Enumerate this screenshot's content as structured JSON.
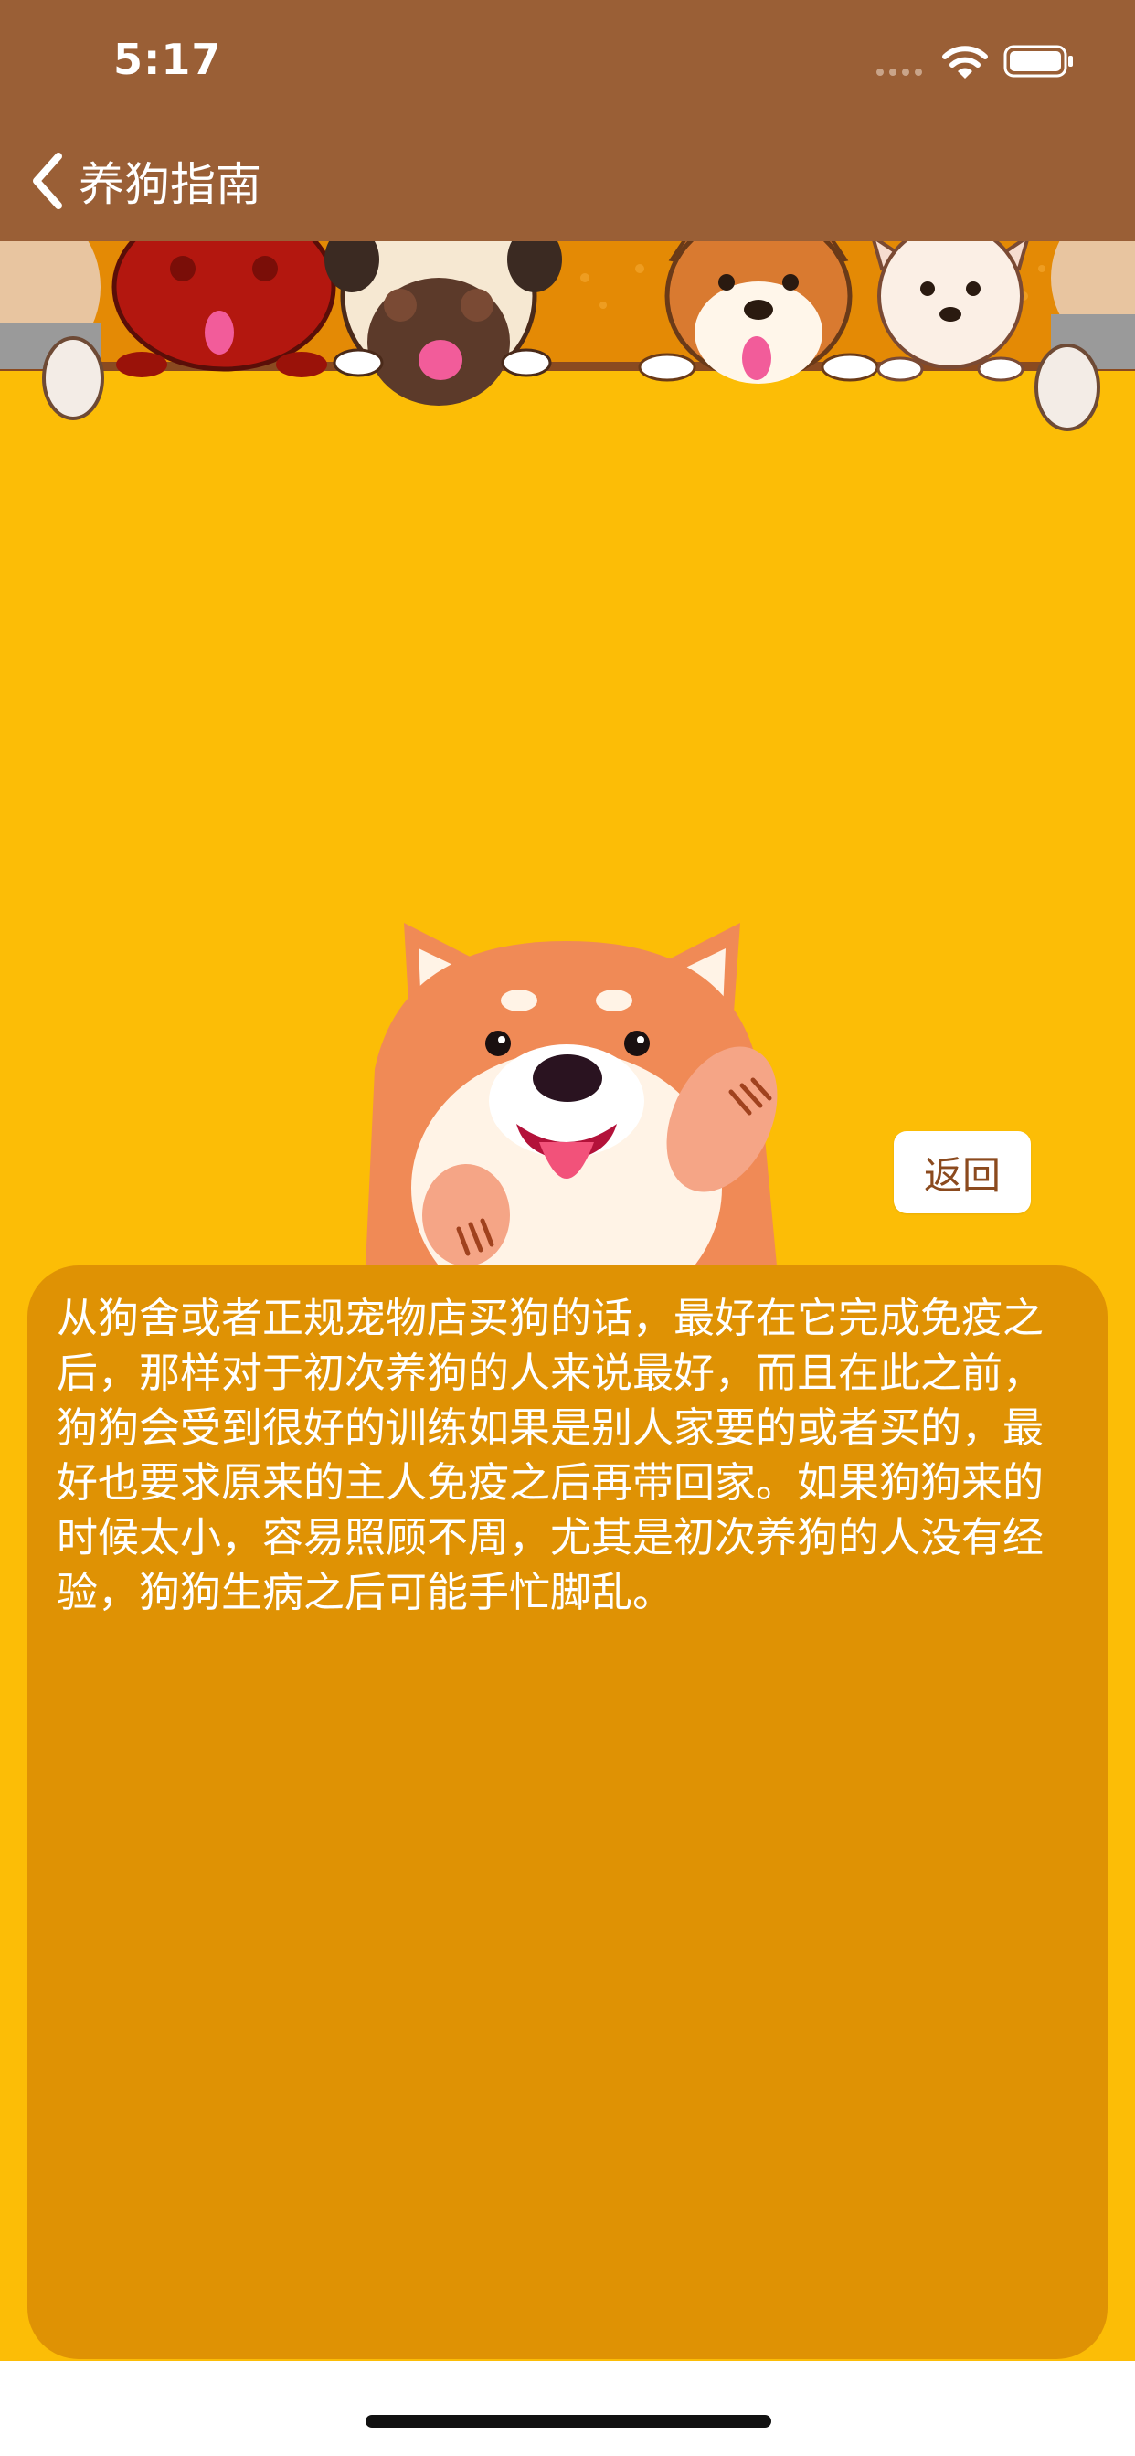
{
  "status_bar": {
    "time": "5:17"
  },
  "nav": {
    "back_icon": "chevron-left-icon",
    "title": "养狗指南"
  },
  "main": {
    "return_button_label": "返回",
    "content_text": "从狗舍或者正规宠物店买狗的话，最好在它完成免疫之后，那样对于初次养狗的人来说最好，而且在此之前，狗狗会受到很好的训练如果是别人家要的或者买的，最好也要求原来的主人免疫之后再带回家。如果狗狗来的时候太小，容易照顾不周，尤其是初次养狗的人没有经验，狗狗生病之后可能手忙脚乱。"
  },
  "colors": {
    "header_brown": "#9A5F36",
    "background_yellow": "#FCBD06",
    "panel_orange": "#DF9204",
    "button_text_brown": "#8B4A1E"
  }
}
